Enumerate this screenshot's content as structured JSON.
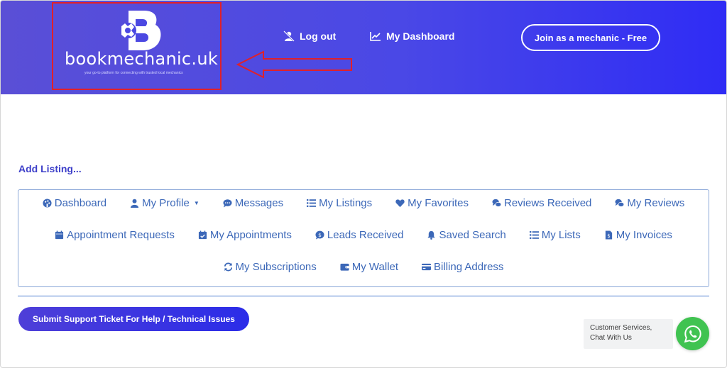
{
  "header": {
    "logo_text": "bookmechanic.uk",
    "logo_tagline": "your go-to platform for connecting with trusted local mechanics",
    "logout_label": "Log out",
    "dashboard_label": "My Dashboard",
    "join_label": "Join as a mechanic - Free"
  },
  "main": {
    "add_listing": "Add Listing..."
  },
  "menu": {
    "row1": [
      {
        "label": "Dashboard",
        "icon": "palette-icon"
      },
      {
        "label": "My Profile",
        "icon": "user-icon"
      },
      {
        "label": "Messages",
        "icon": "comment-icon"
      },
      {
        "label": "My Listings",
        "icon": "list-icon"
      },
      {
        "label": "My Favorites",
        "icon": "heart-icon"
      },
      {
        "label": "Reviews Received",
        "icon": "comments-icon"
      },
      {
        "label": "My Reviews",
        "icon": "comments-icon"
      }
    ],
    "row2": [
      {
        "label": "Appointment Requests",
        "icon": "calendar-icon"
      },
      {
        "label": "My Appointments",
        "icon": "calendar-check-icon"
      },
      {
        "label": "Leads Received",
        "icon": "dollar-comment-icon"
      },
      {
        "label": "Saved Search",
        "icon": "bell-icon"
      },
      {
        "label": "My Lists",
        "icon": "list-icon"
      },
      {
        "label": "My Invoices",
        "icon": "invoice-icon"
      }
    ],
    "row3": [
      {
        "label": "My Subscriptions",
        "icon": "refresh-icon"
      },
      {
        "label": "My Wallet",
        "icon": "wallet-icon"
      },
      {
        "label": "Billing Address",
        "icon": "credit-card-icon"
      }
    ]
  },
  "support": {
    "button_label": "Submit Support Ticket For Help / Technical Issues"
  },
  "chat": {
    "bubble_text": "Customer Services, Chat With Us"
  },
  "colors": {
    "header_start": "#5a4fd6",
    "header_end": "#2f2cf5",
    "menu_text": "#3c68b8",
    "highlight_box": "#e0202a",
    "whatsapp": "#40c351"
  }
}
